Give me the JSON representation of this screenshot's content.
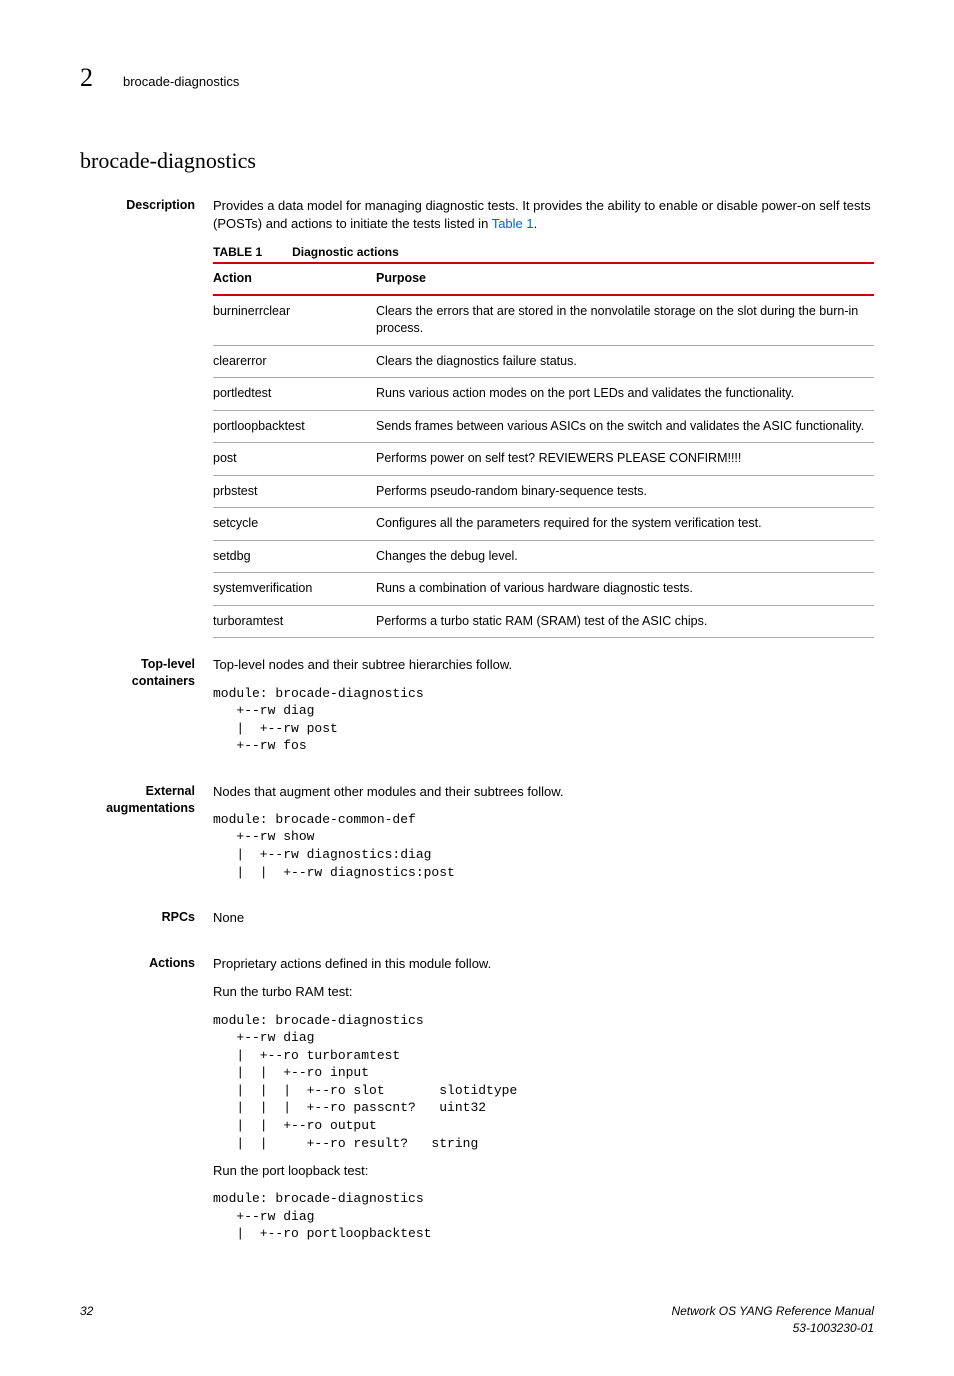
{
  "header": {
    "chapter_num": "2",
    "crumb": "brocade-diagnostics"
  },
  "title": "brocade-diagnostics",
  "description": {
    "label": "Description",
    "text_pre": "Provides a data model for managing diagnostic tests. It provides the ability to enable or disable power-on self tests (POSTs) and actions to initiate the tests listed in ",
    "link_text": "Table 1",
    "text_post": "."
  },
  "table": {
    "caption_num": "TABLE 1",
    "caption_title": "Diagnostic actions",
    "col1": "Action",
    "col2": "Purpose",
    "rows": [
      {
        "action": "burninerrclear",
        "purpose": "Clears the errors that are stored in the nonvolatile storage on the slot during the burn-in process."
      },
      {
        "action": "clearerror",
        "purpose": "Clears the diagnostics failure status."
      },
      {
        "action": "portledtest",
        "purpose": "Runs various action modes on the port LEDs and validates the functionality."
      },
      {
        "action": "portloopbacktest",
        "purpose": "Sends frames between various ASICs on the switch and validates the ASIC functionality."
      },
      {
        "action": "post",
        "purpose": "Performs power on self test? REVIEWERS PLEASE CONFIRM!!!!"
      },
      {
        "action": "prbstest",
        "purpose": "Performs pseudo-random binary-sequence tests."
      },
      {
        "action": "setcycle",
        "purpose": "Configures all the parameters required for the system verification test."
      },
      {
        "action": "setdbg",
        "purpose": "Changes the debug level."
      },
      {
        "action": "systemverification",
        "purpose": "Runs a combination of various hardware diagnostic tests."
      },
      {
        "action": "turboramtest",
        "purpose": "Performs a turbo static RAM (SRAM) test of the ASIC chips."
      }
    ]
  },
  "toplevel": {
    "label": "Top-level containers",
    "text": "Top-level nodes and their subtree hierarchies follow.",
    "code": "module: brocade-diagnostics\n   +--rw diag\n   |  +--rw post\n   +--rw fos"
  },
  "external": {
    "label": "External augmentations",
    "text": "Nodes that augment other modules and their subtrees follow.",
    "code": "module: brocade-common-def\n   +--rw show\n   |  +--rw diagnostics:diag\n   |  |  +--rw diagnostics:post"
  },
  "rpcs": {
    "label": "RPCs",
    "text": "None"
  },
  "actions": {
    "label": "Actions",
    "intro": "Proprietary actions defined in this module follow.",
    "sub1_title": "Run the turbo RAM test:",
    "sub1_code": "module: brocade-diagnostics\n   +--rw diag\n   |  +--ro turboramtest\n   |  |  +--ro input\n   |  |  |  +--ro slot       slotidtype\n   |  |  |  +--ro passcnt?   uint32\n   |  |  +--ro output\n   |  |     +--ro result?   string",
    "sub2_title": "Run the port loopback test:",
    "sub2_code": "module: brocade-diagnostics\n   +--rw diag\n   |  +--ro portloopbacktest"
  },
  "footer": {
    "page": "32",
    "manual": "Network OS YANG Reference Manual",
    "docnum": "53-1003230-01"
  }
}
